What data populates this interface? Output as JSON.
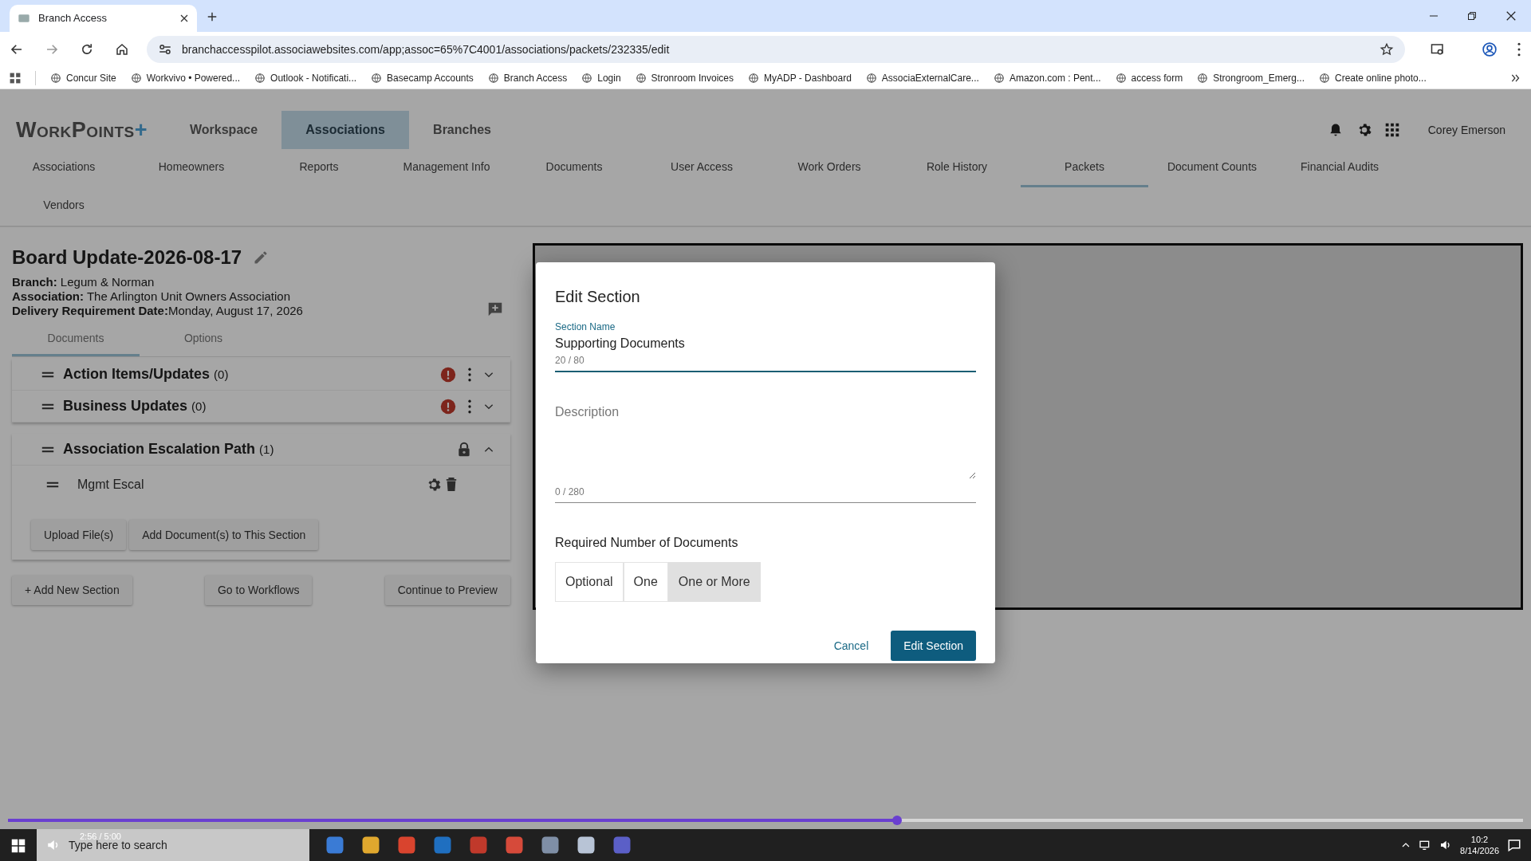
{
  "browser": {
    "tab_title": "Branch Access",
    "url": "branchaccesspilot.associawebsites.com/app;assoc=65%7C4001/associations/packets/232335/edit",
    "bookmarks": [
      {
        "label": "Concur Site"
      },
      {
        "label": "Workvivo • Powered..."
      },
      {
        "label": "Outlook - Notificati..."
      },
      {
        "label": "Basecamp Accounts"
      },
      {
        "label": "Branch Access"
      },
      {
        "label": "Login"
      },
      {
        "label": "Stronroom Invoices"
      },
      {
        "label": "MyADP - Dashboard"
      },
      {
        "label": "AssociaExternalCare..."
      },
      {
        "label": "Amazon.com : Pent..."
      },
      {
        "label": "access form"
      },
      {
        "label": "Strongroom_Emerg..."
      },
      {
        "label": "Create online photo..."
      }
    ]
  },
  "header": {
    "logo": "WorkPoints",
    "logo_mark": "+",
    "user_name": "Corey Emerson",
    "main_tabs": [
      {
        "label": "Workspace",
        "selected": false
      },
      {
        "label": "Associations",
        "selected": true
      },
      {
        "label": "Branches",
        "selected": false
      }
    ]
  },
  "sub_nav": [
    {
      "label": "Associations",
      "selected": false
    },
    {
      "label": "Homeowners",
      "selected": false
    },
    {
      "label": "Reports",
      "selected": false
    },
    {
      "label": "Management Info",
      "selected": false
    },
    {
      "label": "Documents",
      "selected": false
    },
    {
      "label": "User Access",
      "selected": false
    },
    {
      "label": "Work Orders",
      "selected": false
    },
    {
      "label": "Role History",
      "selected": false
    },
    {
      "label": "Packets",
      "selected": true
    },
    {
      "label": "Document Counts",
      "selected": false
    },
    {
      "label": "Financial Audits",
      "selected": false
    },
    {
      "label": "Vendors",
      "selected": false
    }
  ],
  "packet": {
    "title": "Board Update-2026-08-17",
    "details": [
      "**Branch:** Legum & Norman",
      "**Association:** The Arlington Unit Owners Association",
      "**Delivery Requirement Date:**Monday, August 17, 2026"
    ],
    "tabs": [
      {
        "label": "Documents",
        "selected": true
      },
      {
        "label": "Options",
        "selected": false
      }
    ],
    "sections": [
      {
        "title": "Action Items/Updates",
        "count": "(0)",
        "warning": true,
        "locked": false,
        "expanded": false
      },
      {
        "title": "Business Updates",
        "count": "(0)",
        "warning": true,
        "locked": false,
        "expanded": false
      },
      {
        "title": "Association Escalation Path",
        "count": "(1)",
        "warning": false,
        "locked": true,
        "expanded": true,
        "documents": [
          {
            "name": "Mgmt Escal"
          }
        ],
        "actions": [
          "Upload File(s)",
          "Add Document(s) to This Section"
        ]
      }
    ],
    "footer_buttons": [
      "+ Add New Section",
      "Go to Workflows",
      "Continue to Preview"
    ]
  },
  "dialog": {
    "title": "Edit Section",
    "name_field": {
      "label": "Section Name",
      "value": "Supporting Documents",
      "counter": "20 / 80"
    },
    "description_field": {
      "placeholder": "Description",
      "counter": "0 / 280"
    },
    "required": {
      "label": "Required Number of Documents",
      "options": [
        {
          "label": "Optional",
          "selected": false
        },
        {
          "label": "One",
          "selected": false
        },
        {
          "label": "One or More",
          "selected": true
        }
      ]
    },
    "cancel": "Cancel",
    "submit": "Edit Section"
  },
  "video": {
    "level": 0.587,
    "time": "2:56 / 5:00"
  },
  "taskbar": {
    "search_placeholder": "Type here to search",
    "time": "10:2",
    "date": "8/14/2026"
  }
}
